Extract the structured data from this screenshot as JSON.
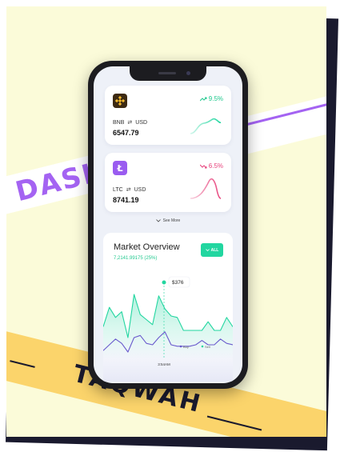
{
  "poster": {
    "band_word_top": "DASHB",
    "band_word_bottom": "TAQWAH"
  },
  "colors": {
    "poster_bg": "#fbfbd9",
    "purple": "#a463f2",
    "yellow": "#fbd46b",
    "green": "#22d6a0",
    "pink": "#e7447d",
    "dark": "#1a1a2e"
  },
  "cards": [
    {
      "icon": "binance-icon",
      "symbol": "BNB",
      "quote": "USD",
      "price": "6547.79",
      "change": "9.5%",
      "direction": "up"
    },
    {
      "icon": "litecoin-icon",
      "symbol": "LTC",
      "quote": "USD",
      "price": "8741.19",
      "change": "6.5%",
      "direction": "down"
    }
  ],
  "see_more": "See More",
  "overview": {
    "title": "Market Overview",
    "subtitle": "7,2141.99175 (25%)",
    "filter_label": "ALL",
    "tooltip_value": "$376",
    "time_label": "3:54AM",
    "legend_buy": "Buy",
    "legend_sell": "Sell"
  },
  "chart_data": {
    "type": "line",
    "title": "Market Overview",
    "series": [
      {
        "name": "Sell",
        "values": [
          0.45,
          0.72,
          0.58,
          0.66,
          0.3,
          0.9,
          0.62,
          0.55,
          0.48,
          0.88,
          0.7,
          0.6,
          0.58,
          0.4,
          0.4,
          0.4,
          0.4,
          0.52,
          0.4,
          0.4,
          0.58,
          0.45
        ]
      },
      {
        "name": "Buy",
        "values": [
          0.12,
          0.2,
          0.28,
          0.22,
          0.1,
          0.3,
          0.33,
          0.22,
          0.2,
          0.3,
          0.38,
          0.2,
          0.18,
          0.18,
          0.18,
          0.2,
          0.26,
          0.2,
          0.2,
          0.28,
          0.22,
          0.2
        ]
      }
    ],
    "highlight": {
      "series": "Sell",
      "label": "$376",
      "time": "3:54AM"
    },
    "legend": "bottom-right"
  }
}
